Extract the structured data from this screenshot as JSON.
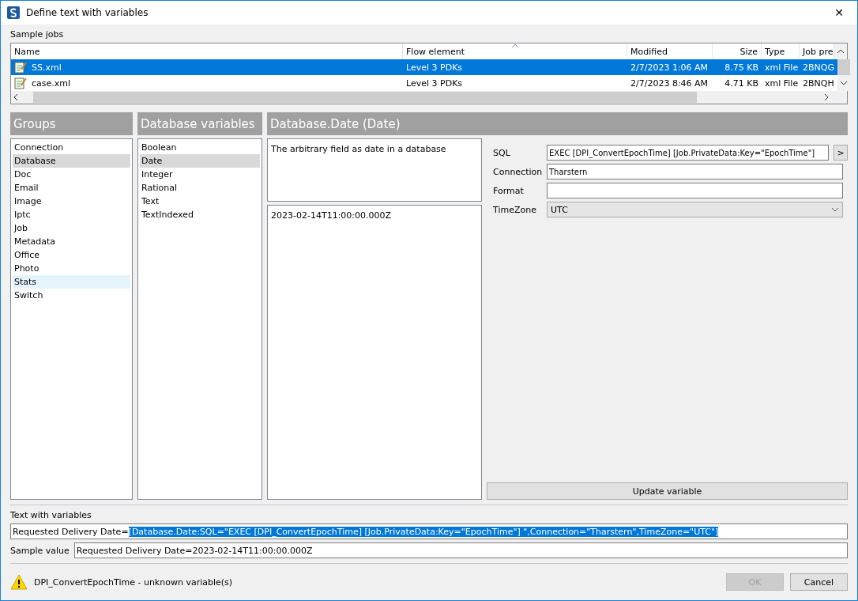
{
  "window": {
    "title": "Define text with variables",
    "close": "✕"
  },
  "sample_jobs": {
    "label": "Sample jobs",
    "columns": [
      {
        "label": "Name",
        "sorted": false
      },
      {
        "label": "Flow element",
        "sorted": true
      },
      {
        "label": "Modified",
        "sorted": false
      },
      {
        "label": "Size",
        "sorted": false
      },
      {
        "label": "Type",
        "sorted": false
      },
      {
        "label": "Job pre",
        "sorted": false
      }
    ],
    "rows": [
      {
        "selected": true,
        "cells": [
          "SS.xml",
          "Level 3 PDKs",
          "2/7/2023 1:06 AM",
          "8.75 KB",
          "xml File",
          "2BNQG"
        ]
      },
      {
        "selected": false,
        "cells": [
          "case.xml",
          "Level 3 PDKs",
          "2/7/2023 8:46 AM",
          "4.71 KB",
          "xml File",
          "2BNQH"
        ]
      }
    ]
  },
  "groups": {
    "title": "Groups",
    "items": [
      {
        "label": "Connection",
        "selected": false,
        "hovered": false
      },
      {
        "label": "Database",
        "selected": true,
        "hovered": false
      },
      {
        "label": "Doc",
        "selected": false,
        "hovered": false
      },
      {
        "label": "Email",
        "selected": false,
        "hovered": false
      },
      {
        "label": "Image",
        "selected": false,
        "hovered": false
      },
      {
        "label": "Iptc",
        "selected": false,
        "hovered": false
      },
      {
        "label": "Job",
        "selected": false,
        "hovered": false
      },
      {
        "label": "Metadata",
        "selected": false,
        "hovered": false
      },
      {
        "label": "Office",
        "selected": false,
        "hovered": false
      },
      {
        "label": "Photo",
        "selected": false,
        "hovered": false
      },
      {
        "label": "Stats",
        "selected": false,
        "hovered": true
      },
      {
        "label": "Switch",
        "selected": false,
        "hovered": false
      }
    ]
  },
  "variables": {
    "title": "Database variables",
    "items": [
      {
        "label": "Boolean",
        "selected": false
      },
      {
        "label": "Date",
        "selected": true
      },
      {
        "label": "Integer",
        "selected": false
      },
      {
        "label": "Rational",
        "selected": false
      },
      {
        "label": "Text",
        "selected": false
      },
      {
        "label": "TextIndexed",
        "selected": false
      }
    ]
  },
  "detail": {
    "title": "Database.Date (Date)",
    "description": "The arbitrary field as date in a database",
    "value": "2023-02-14T11:00:00.000Z",
    "fields": [
      {
        "kind": "text-button",
        "label": "SQL",
        "value": "EXEC [DPI_ConvertEpochTime] [Job.PrivateData:Key=\"EpochTime\"]",
        "button": ">"
      },
      {
        "kind": "text",
        "label": "Connection",
        "value": "Tharstern"
      },
      {
        "kind": "text",
        "label": "Format"
      },
      {
        "kind": "select",
        "label": "TimeZone",
        "value": "UTC"
      }
    ],
    "update_button": "Update variable"
  },
  "text_with_variables": {
    "label": "Text with variables",
    "prefix": "Requested Delivery Date=",
    "selected_text": "[Database.Date:SQL=\"EXEC [DPI_ConvertEpochTime] [Job.PrivateData:Key=\"EpochTime\"] \",Connection=\"Tharstern\",TimeZone=\"UTC\"]"
  },
  "sample_value": {
    "label": "Sample value",
    "value": "Requested Delivery Date=2023-02-14T11:00:00.000Z"
  },
  "status": {
    "message": "DPI_ConvertEpochTime - unknown variable(s)",
    "warning": true
  },
  "buttons": [
    {
      "label": "OK",
      "disabled": true
    },
    {
      "label": "Cancel",
      "disabled": false
    }
  ]
}
